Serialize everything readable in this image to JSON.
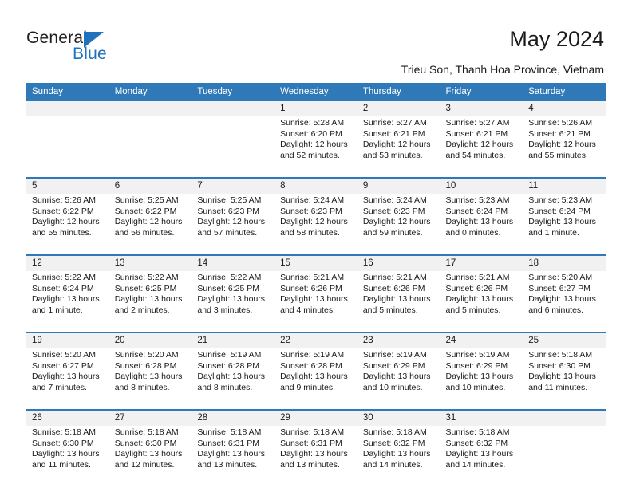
{
  "logo": {
    "word_one": "General",
    "word_two": "Blue",
    "triangle_icon": "triangle-icon",
    "brand_color": "#1f72bb"
  },
  "header": {
    "title": "May 2024",
    "subtitle": "Trieu Son, Thanh Hoa Province, Vietnam"
  },
  "calendar": {
    "header_bg": "#3079b8",
    "daynum_bg": "#f1f1f1",
    "weekdays": [
      "Sunday",
      "Monday",
      "Tuesday",
      "Wednesday",
      "Thursday",
      "Friday",
      "Saturday"
    ],
    "weeks": [
      {
        "days": [
          {
            "num": "",
            "sunrise": "",
            "sunset": "",
            "daylight1": "",
            "daylight2": ""
          },
          {
            "num": "",
            "sunrise": "",
            "sunset": "",
            "daylight1": "",
            "daylight2": ""
          },
          {
            "num": "",
            "sunrise": "",
            "sunset": "",
            "daylight1": "",
            "daylight2": ""
          },
          {
            "num": "1",
            "sunrise": "Sunrise: 5:28 AM",
            "sunset": "Sunset: 6:20 PM",
            "daylight1": "Daylight: 12 hours",
            "daylight2": "and 52 minutes."
          },
          {
            "num": "2",
            "sunrise": "Sunrise: 5:27 AM",
            "sunset": "Sunset: 6:21 PM",
            "daylight1": "Daylight: 12 hours",
            "daylight2": "and 53 minutes."
          },
          {
            "num": "3",
            "sunrise": "Sunrise: 5:27 AM",
            "sunset": "Sunset: 6:21 PM",
            "daylight1": "Daylight: 12 hours",
            "daylight2": "and 54 minutes."
          },
          {
            "num": "4",
            "sunrise": "Sunrise: 5:26 AM",
            "sunset": "Sunset: 6:21 PM",
            "daylight1": "Daylight: 12 hours",
            "daylight2": "and 55 minutes."
          }
        ]
      },
      {
        "days": [
          {
            "num": "5",
            "sunrise": "Sunrise: 5:26 AM",
            "sunset": "Sunset: 6:22 PM",
            "daylight1": "Daylight: 12 hours",
            "daylight2": "and 55 minutes."
          },
          {
            "num": "6",
            "sunrise": "Sunrise: 5:25 AM",
            "sunset": "Sunset: 6:22 PM",
            "daylight1": "Daylight: 12 hours",
            "daylight2": "and 56 minutes."
          },
          {
            "num": "7",
            "sunrise": "Sunrise: 5:25 AM",
            "sunset": "Sunset: 6:23 PM",
            "daylight1": "Daylight: 12 hours",
            "daylight2": "and 57 minutes."
          },
          {
            "num": "8",
            "sunrise": "Sunrise: 5:24 AM",
            "sunset": "Sunset: 6:23 PM",
            "daylight1": "Daylight: 12 hours",
            "daylight2": "and 58 minutes."
          },
          {
            "num": "9",
            "sunrise": "Sunrise: 5:24 AM",
            "sunset": "Sunset: 6:23 PM",
            "daylight1": "Daylight: 12 hours",
            "daylight2": "and 59 minutes."
          },
          {
            "num": "10",
            "sunrise": "Sunrise: 5:23 AM",
            "sunset": "Sunset: 6:24 PM",
            "daylight1": "Daylight: 13 hours",
            "daylight2": "and 0 minutes."
          },
          {
            "num": "11",
            "sunrise": "Sunrise: 5:23 AM",
            "sunset": "Sunset: 6:24 PM",
            "daylight1": "Daylight: 13 hours",
            "daylight2": "and 1 minute."
          }
        ]
      },
      {
        "days": [
          {
            "num": "12",
            "sunrise": "Sunrise: 5:22 AM",
            "sunset": "Sunset: 6:24 PM",
            "daylight1": "Daylight: 13 hours",
            "daylight2": "and 1 minute."
          },
          {
            "num": "13",
            "sunrise": "Sunrise: 5:22 AM",
            "sunset": "Sunset: 6:25 PM",
            "daylight1": "Daylight: 13 hours",
            "daylight2": "and 2 minutes."
          },
          {
            "num": "14",
            "sunrise": "Sunrise: 5:22 AM",
            "sunset": "Sunset: 6:25 PM",
            "daylight1": "Daylight: 13 hours",
            "daylight2": "and 3 minutes."
          },
          {
            "num": "15",
            "sunrise": "Sunrise: 5:21 AM",
            "sunset": "Sunset: 6:26 PM",
            "daylight1": "Daylight: 13 hours",
            "daylight2": "and 4 minutes."
          },
          {
            "num": "16",
            "sunrise": "Sunrise: 5:21 AM",
            "sunset": "Sunset: 6:26 PM",
            "daylight1": "Daylight: 13 hours",
            "daylight2": "and 5 minutes."
          },
          {
            "num": "17",
            "sunrise": "Sunrise: 5:21 AM",
            "sunset": "Sunset: 6:26 PM",
            "daylight1": "Daylight: 13 hours",
            "daylight2": "and 5 minutes."
          },
          {
            "num": "18",
            "sunrise": "Sunrise: 5:20 AM",
            "sunset": "Sunset: 6:27 PM",
            "daylight1": "Daylight: 13 hours",
            "daylight2": "and 6 minutes."
          }
        ]
      },
      {
        "days": [
          {
            "num": "19",
            "sunrise": "Sunrise: 5:20 AM",
            "sunset": "Sunset: 6:27 PM",
            "daylight1": "Daylight: 13 hours",
            "daylight2": "and 7 minutes."
          },
          {
            "num": "20",
            "sunrise": "Sunrise: 5:20 AM",
            "sunset": "Sunset: 6:28 PM",
            "daylight1": "Daylight: 13 hours",
            "daylight2": "and 8 minutes."
          },
          {
            "num": "21",
            "sunrise": "Sunrise: 5:19 AM",
            "sunset": "Sunset: 6:28 PM",
            "daylight1": "Daylight: 13 hours",
            "daylight2": "and 8 minutes."
          },
          {
            "num": "22",
            "sunrise": "Sunrise: 5:19 AM",
            "sunset": "Sunset: 6:28 PM",
            "daylight1": "Daylight: 13 hours",
            "daylight2": "and 9 minutes."
          },
          {
            "num": "23",
            "sunrise": "Sunrise: 5:19 AM",
            "sunset": "Sunset: 6:29 PM",
            "daylight1": "Daylight: 13 hours",
            "daylight2": "and 10 minutes."
          },
          {
            "num": "24",
            "sunrise": "Sunrise: 5:19 AM",
            "sunset": "Sunset: 6:29 PM",
            "daylight1": "Daylight: 13 hours",
            "daylight2": "and 10 minutes."
          },
          {
            "num": "25",
            "sunrise": "Sunrise: 5:18 AM",
            "sunset": "Sunset: 6:30 PM",
            "daylight1": "Daylight: 13 hours",
            "daylight2": "and 11 minutes."
          }
        ]
      },
      {
        "days": [
          {
            "num": "26",
            "sunrise": "Sunrise: 5:18 AM",
            "sunset": "Sunset: 6:30 PM",
            "daylight1": "Daylight: 13 hours",
            "daylight2": "and 11 minutes."
          },
          {
            "num": "27",
            "sunrise": "Sunrise: 5:18 AM",
            "sunset": "Sunset: 6:30 PM",
            "daylight1": "Daylight: 13 hours",
            "daylight2": "and 12 minutes."
          },
          {
            "num": "28",
            "sunrise": "Sunrise: 5:18 AM",
            "sunset": "Sunset: 6:31 PM",
            "daylight1": "Daylight: 13 hours",
            "daylight2": "and 13 minutes."
          },
          {
            "num": "29",
            "sunrise": "Sunrise: 5:18 AM",
            "sunset": "Sunset: 6:31 PM",
            "daylight1": "Daylight: 13 hours",
            "daylight2": "and 13 minutes."
          },
          {
            "num": "30",
            "sunrise": "Sunrise: 5:18 AM",
            "sunset": "Sunset: 6:32 PM",
            "daylight1": "Daylight: 13 hours",
            "daylight2": "and 14 minutes."
          },
          {
            "num": "31",
            "sunrise": "Sunrise: 5:18 AM",
            "sunset": "Sunset: 6:32 PM",
            "daylight1": "Daylight: 13 hours",
            "daylight2": "and 14 minutes."
          },
          {
            "num": "",
            "sunrise": "",
            "sunset": "",
            "daylight1": "",
            "daylight2": ""
          }
        ]
      }
    ]
  }
}
